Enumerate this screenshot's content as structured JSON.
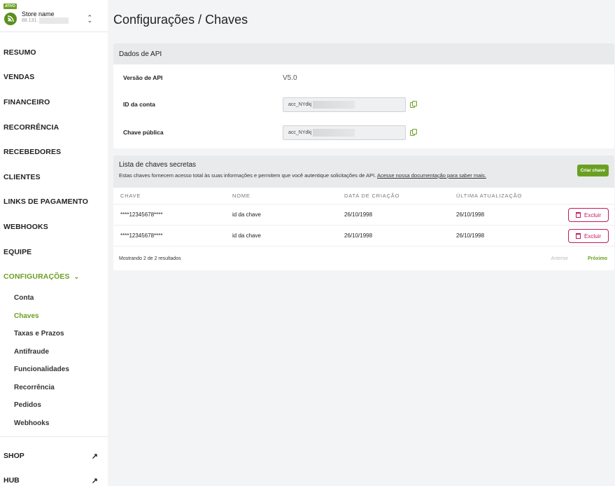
{
  "sidebar": {
    "store": {
      "badge": "ATIVO",
      "name": "Store name",
      "id": "88.131."
    },
    "nav": [
      {
        "label": "RESUMO"
      },
      {
        "label": "VENDAS"
      },
      {
        "label": "FINANCEIRO"
      },
      {
        "label": "RECORRÊNCIA"
      },
      {
        "label": "RECEBEDORES"
      },
      {
        "label": "CLIENTES"
      },
      {
        "label": "LINKS DE PAGAMENTO"
      },
      {
        "label": "WEBHOOKS"
      },
      {
        "label": "EQUIPE"
      },
      {
        "label": "CONFIGURAÇÕES"
      }
    ],
    "sub": [
      {
        "label": "Conta"
      },
      {
        "label": "Chaves"
      },
      {
        "label": "Taxas e Prazos"
      },
      {
        "label": "Antifraude"
      },
      {
        "label": "Funcionalidades"
      },
      {
        "label": "Recorrência"
      },
      {
        "label": "Pedidos"
      },
      {
        "label": "Webhooks"
      }
    ],
    "external": [
      {
        "label": "SHOP"
      },
      {
        "label": "HUB"
      }
    ]
  },
  "page": {
    "title": "Configurações / Chaves"
  },
  "api": {
    "header": "Dados de API",
    "version_label": "Versão de API",
    "version_value": "V5.0",
    "account_label": "ID da conta",
    "account_value": "acc_NYdkj",
    "public_key_label": "Chave pública",
    "public_key_value": "acc_NYdkj"
  },
  "keys": {
    "title": "Lista de chaves secretas",
    "description": "Estas chaves fornecem acesso total às suas informações e permitem que você autentique solicitações de API.",
    "doc_link": "Acesse nossa documentação para saber mais.",
    "create_button": "Criar chave",
    "columns": [
      "CHAVE",
      "NOME",
      "DATA DE CRIAÇÃO",
      "ÚLTIMA ATUALIZAÇÃO"
    ],
    "rows": [
      {
        "key": "****12345678****",
        "name": "id da chave",
        "created": "26/10/1998",
        "updated": "26/10/1998",
        "delete": "Excluir"
      },
      {
        "key": "****12345678****",
        "name": "id da chave",
        "created": "26/10/1998",
        "updated": "26/10/1998",
        "delete": "Excluir"
      }
    ],
    "footer": {
      "summary": "Mostrando 2 de 2 resultados",
      "prev": "Anterior",
      "next": "Próximo"
    }
  },
  "colors": {
    "accent": "#6aa022",
    "danger": "#c2185b"
  }
}
